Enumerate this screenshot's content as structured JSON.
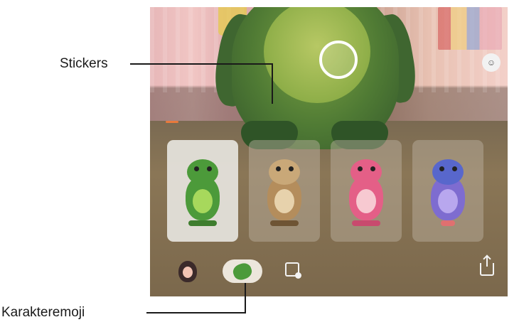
{
  "callouts": {
    "stickers": "Stickers",
    "ar_emoji": "Karakteremoji"
  },
  "stickers_tab": {
    "label": "",
    "accent_color": "#e97a3c"
  },
  "emoji_cards": [
    {
      "character": "frog",
      "selected": true
    },
    {
      "character": "sloth",
      "selected": false
    },
    {
      "character": "bear",
      "selected": false
    },
    {
      "character": "bird",
      "selected": false
    }
  ],
  "toolbar": {
    "icons": [
      "avatar-icon",
      "ar-emoji-icon",
      "sticker-maker-icon",
      "share-icon"
    ]
  },
  "icons": {
    "capture": "capture-button",
    "top_right": "emoji-face-icon"
  }
}
